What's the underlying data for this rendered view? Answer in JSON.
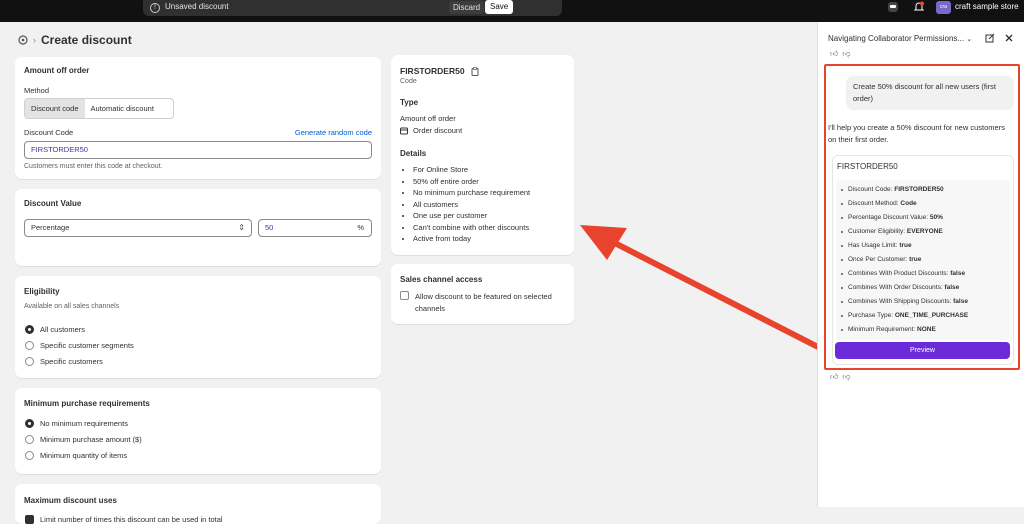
{
  "topbar": {
    "unsaved_label": "Unsaved discount",
    "discard_label": "Discard",
    "save_label": "Save",
    "store_initials": "cra",
    "store_name": "craft sample store"
  },
  "page": {
    "title": "Create discount"
  },
  "amount_card": {
    "title": "Amount off order",
    "method_label": "Method",
    "method_options": [
      "Discount code",
      "Automatic discount"
    ],
    "code_label": "Discount Code",
    "generate_link": "Generate random code",
    "code_value": "FIRSTORDER50",
    "help_text": "Customers must enter this code at checkout."
  },
  "value_card": {
    "title": "Discount Value",
    "type_value": "Percentage",
    "amount_value": "50",
    "suffix": "%"
  },
  "eligibility_card": {
    "title": "Eligibility",
    "subtitle": "Available on all sales channels",
    "options": [
      "All customers",
      "Specific customer segments",
      "Specific customers"
    ]
  },
  "min_card": {
    "title": "Minimum purchase requirements",
    "options": [
      "No minimum requirements",
      "Minimum purchase amount ($)",
      "Minimum quantity of items"
    ]
  },
  "max_card": {
    "title": "Maximum discount uses",
    "option": "Limit number of times this discount can be used in total"
  },
  "summary": {
    "code": "FIRSTORDER50",
    "code_sub": "Code",
    "type_title": "Type",
    "type_value": "Amount off order",
    "type_detail": "Order discount",
    "details_title": "Details",
    "details": [
      "For Online Store",
      "50% off entire order",
      "No minimum purchase requirement",
      "All customers",
      "One use per customer",
      "Can't combine with other discounts",
      "Active from today"
    ]
  },
  "sales_channel": {
    "title": "Sales channel access",
    "option": "Allow discount to be featured on selected channels"
  },
  "assistant": {
    "title": "Navigating Collaborator Permissions...",
    "user_message": "Create 50% discount for all new users (first order)",
    "reply": "I'll help you create a 50% discount for new customers on their first order.",
    "card_title": "FIRSTORDER50",
    "fields": [
      {
        "k": "Discount Code:",
        "v": "FIRSTORDER50"
      },
      {
        "k": "Discount Method:",
        "v": "Code"
      },
      {
        "k": "Percentage Discount Value:",
        "v": "50%"
      },
      {
        "k": "Customer Eligibility:",
        "v": "EVERYONE"
      },
      {
        "k": "Has Usage Limit:",
        "v": "true"
      },
      {
        "k": "Once Per Customer:",
        "v": "true"
      },
      {
        "k": "Combines With Product Discounts:",
        "v": "false"
      },
      {
        "k": "Combines With Order Discounts:",
        "v": "false"
      },
      {
        "k": "Combines With Shipping Discounts:",
        "v": "false"
      },
      {
        "k": "Purchase Type:",
        "v": "ONE_TIME_PURCHASE"
      },
      {
        "k": "Minimum Requirement:",
        "v": "NONE"
      }
    ],
    "preview_label": "Preview"
  },
  "colors": {
    "highlight": "#e8432d",
    "preview_button": "#6c2bd9",
    "link": "#005bd3"
  }
}
